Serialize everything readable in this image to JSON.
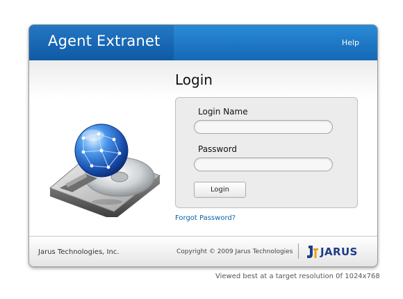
{
  "header": {
    "app_title": "Agent Extranet",
    "help_label": "Help"
  },
  "login": {
    "heading": "Login",
    "login_name_label": "Login Name",
    "login_name_value": "",
    "password_label": "Password",
    "password_value": "",
    "login_button_label": "Login",
    "forgot_password_label": "Forgot Password?"
  },
  "footer": {
    "company": "Jarus Technologies, Inc.",
    "copyright": "Copyright © 2009 Jarus Technologies",
    "brand_text": "JARUS"
  },
  "note": "Viewed best at a target resolution 0f 1024x768",
  "icons": {
    "illustration": "hard-drive-globe-icon",
    "brand_logo": "jarus-logo-icon"
  },
  "colors": {
    "header_blue": "#1568b5",
    "link_blue": "#0b63a8",
    "brand_navy": "#1d3c88",
    "brand_gold": "#e8a21a"
  }
}
